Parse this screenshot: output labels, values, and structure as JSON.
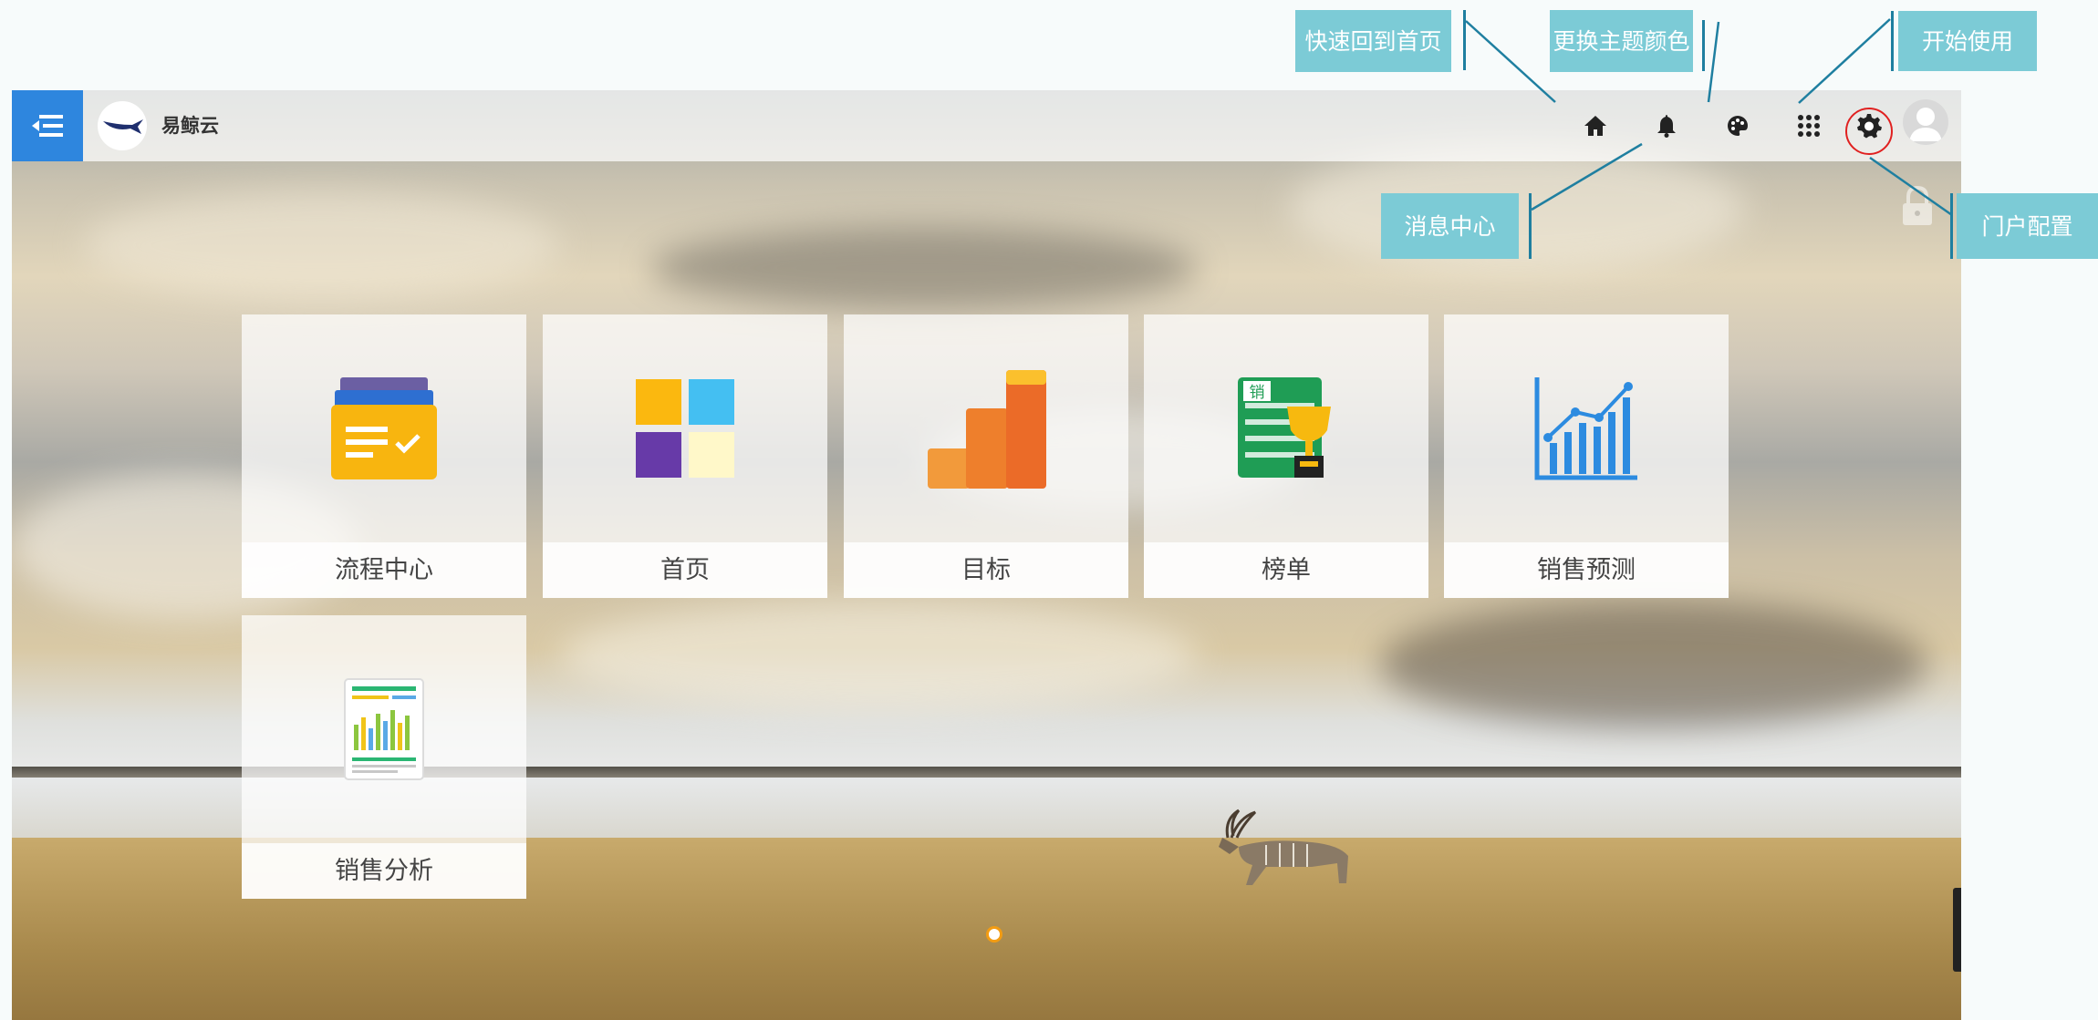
{
  "app": {
    "title": "易鲸云"
  },
  "header": {
    "icons": [
      "menu-toggle-icon",
      "whale-logo-icon",
      "home-icon",
      "bell-icon",
      "palette-icon",
      "apps-grid-icon",
      "gear-icon",
      "avatar-icon"
    ]
  },
  "tiles": [
    {
      "label": "流程中心",
      "icon": "process-center-icon"
    },
    {
      "label": "首页",
      "icon": "home-tiles-icon"
    },
    {
      "label": "目标",
      "icon": "target-bars-icon"
    },
    {
      "label": "榜单",
      "icon": "leaderboard-trophy-icon"
    },
    {
      "label": "销售预测",
      "icon": "sales-forecast-chart-icon"
    },
    {
      "label": "销售分析",
      "icon": "sales-analysis-report-icon"
    }
  ],
  "callouts": {
    "home": "快速回到首页",
    "theme": "更换主题颜色",
    "start": "开始使用",
    "messages": "消息中心",
    "portal": "门户配置"
  },
  "pager": {
    "current": 1,
    "total": 1
  },
  "colors": {
    "menu_blue": "#2e86de",
    "callout_bg": "#7ccbd6",
    "highlight_red": "#e0201f",
    "dot_orange": "#f39c12"
  }
}
